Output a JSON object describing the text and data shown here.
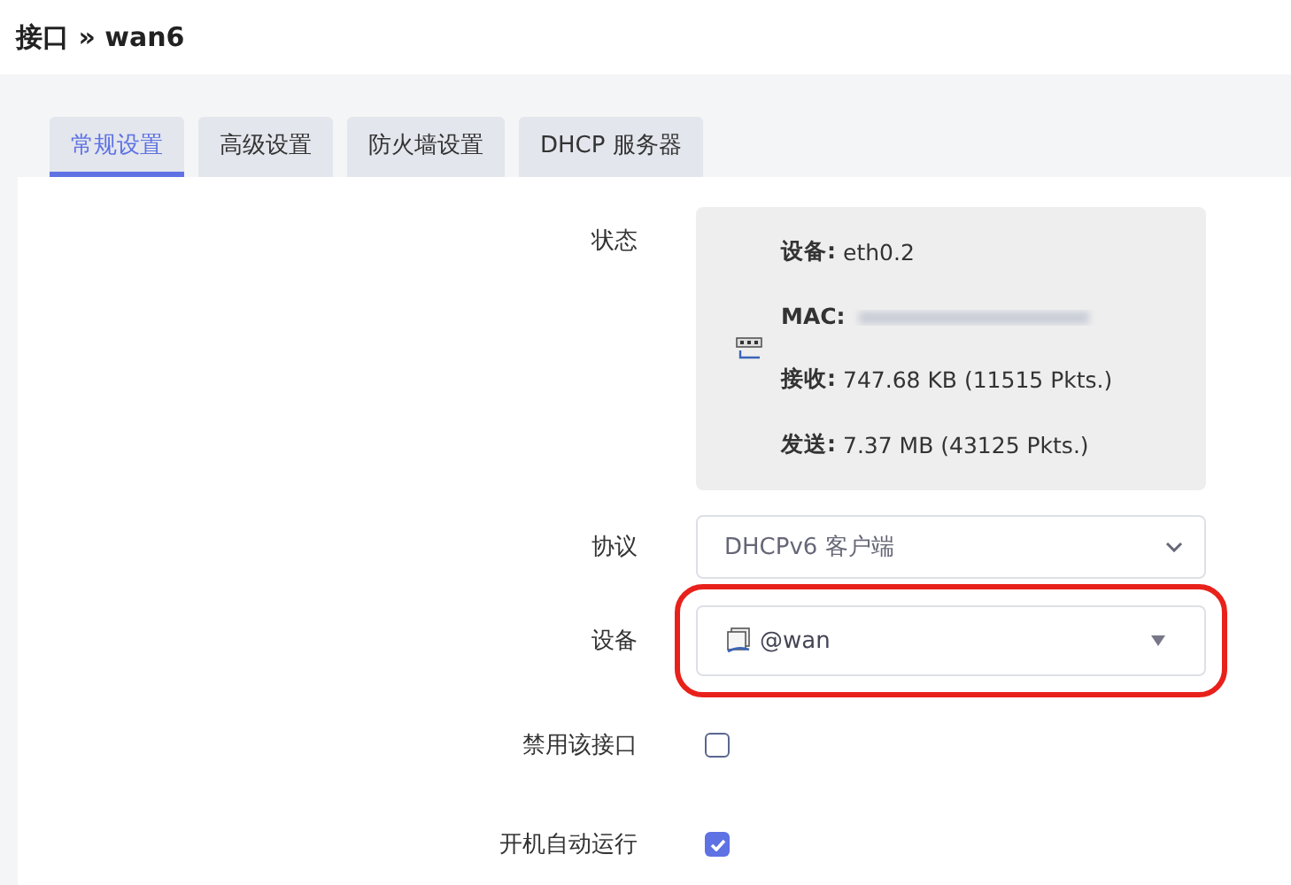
{
  "page_title": "接口 » wan6",
  "tabs": [
    {
      "label": "常规设置",
      "selected": true
    },
    {
      "label": "高级设置",
      "selected": false
    },
    {
      "label": "防火墙设置",
      "selected": false
    },
    {
      "label": "DHCP 服务器",
      "selected": false
    }
  ],
  "fields": [
    {
      "kind": "status",
      "label": "状态",
      "lines": [
        {
          "key": "设备:",
          "value": "eth0.2"
        },
        {
          "key": "MAC:",
          "value_hidden": true
        },
        {
          "key": "接收:",
          "value": "747.68 KB (11515 Pkts.)"
        },
        {
          "key": "发送:",
          "value": "7.37 MB (43125 Pkts.)"
        }
      ]
    },
    {
      "kind": "select",
      "label": "协议",
      "value": "DHCPv6 客户端"
    },
    {
      "kind": "device",
      "label": "设备",
      "value": "@wan",
      "highlighted": true
    },
    {
      "kind": "checkbox",
      "label": "禁用该接口",
      "checked": false
    },
    {
      "kind": "checkbox",
      "label": "开机自动运行",
      "checked": true
    }
  ]
}
